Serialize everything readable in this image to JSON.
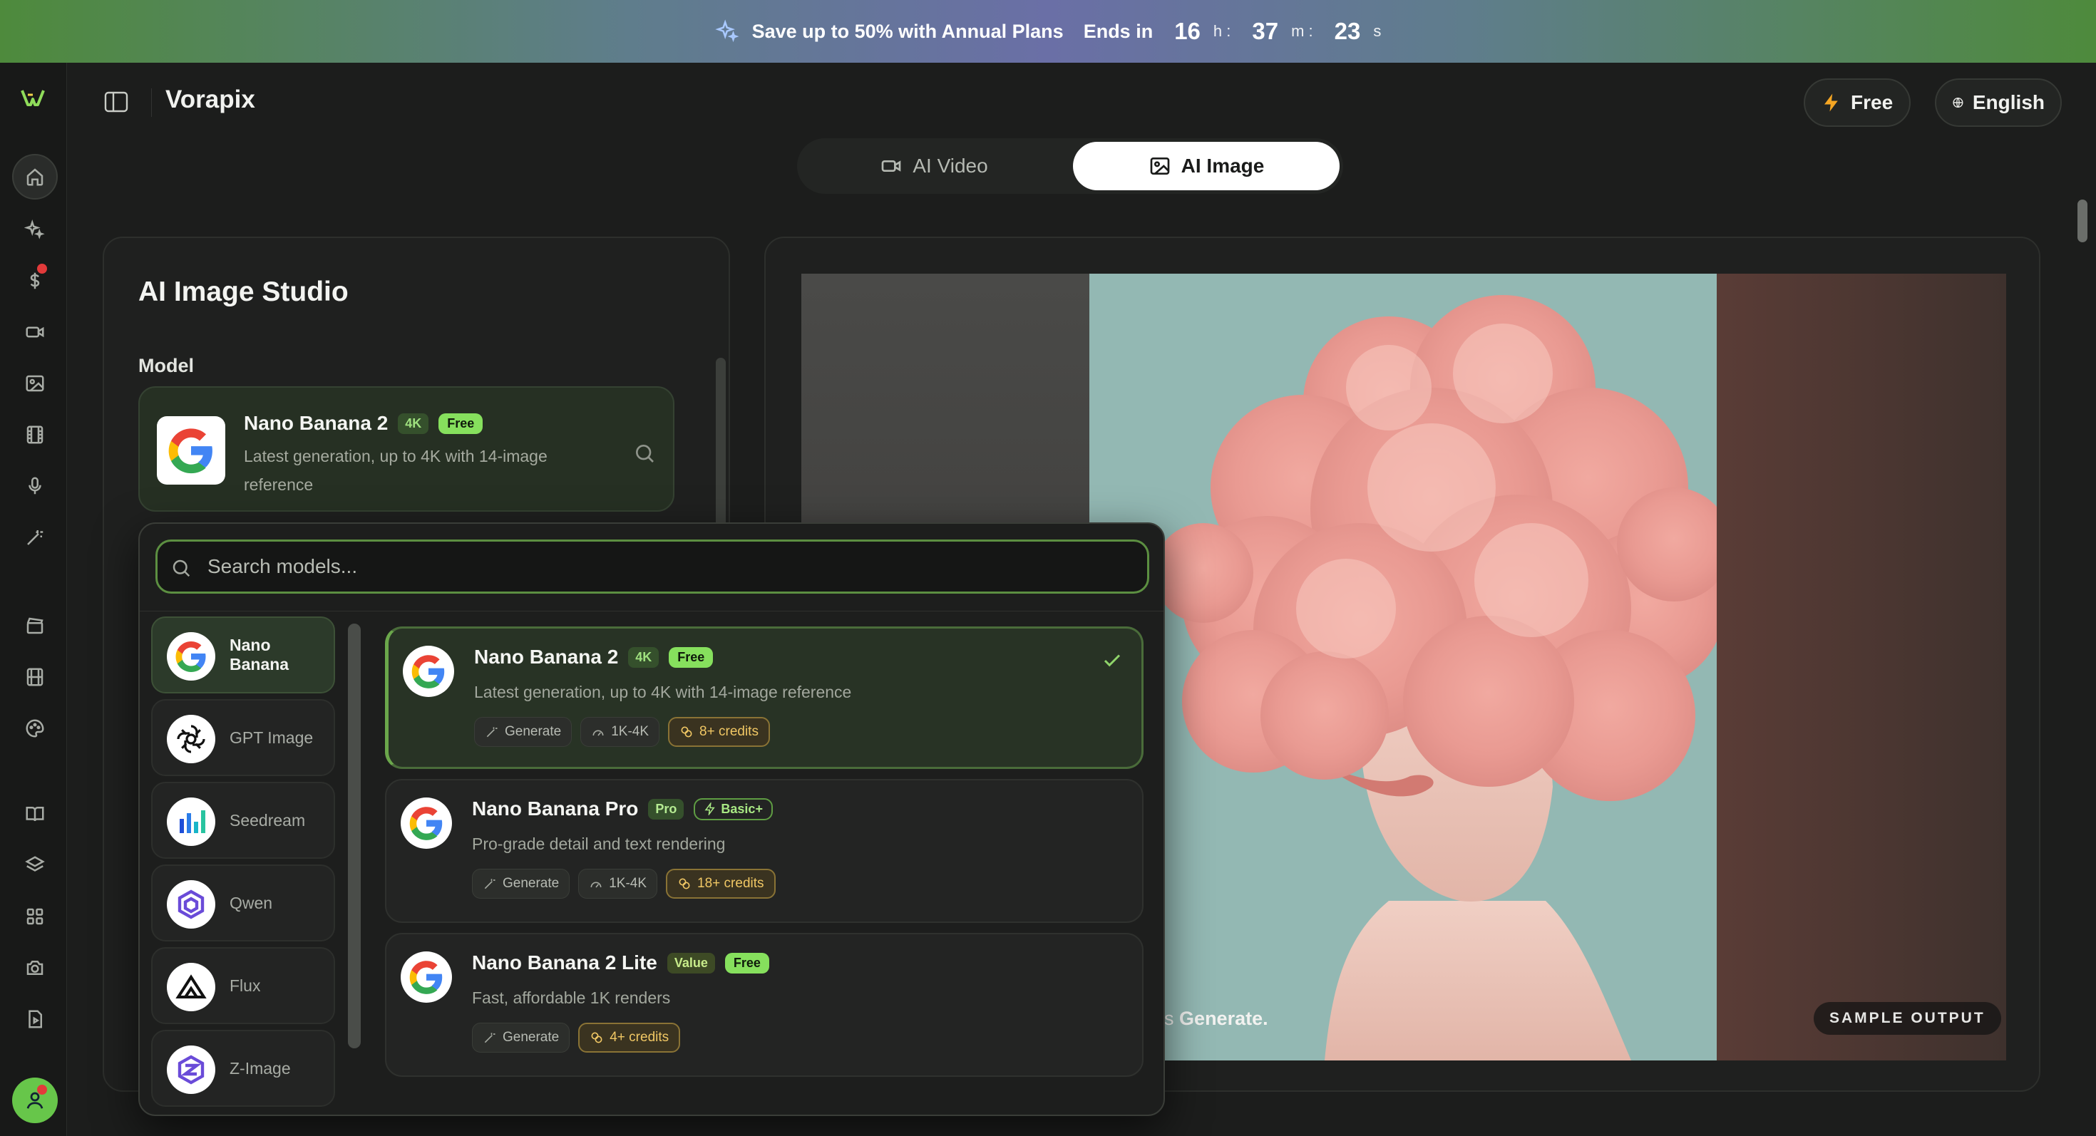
{
  "banner": {
    "text": "Save up to 50% with Annual Plans",
    "ends_label": "Ends in",
    "hours": "16",
    "hours_unit": "h :",
    "minutes": "37",
    "minutes_unit": "m :",
    "seconds": "23",
    "seconds_unit": "s"
  },
  "header": {
    "brand": "Vorapix",
    "plan_label": "Free",
    "language_label": "English"
  },
  "modes": {
    "video_label": "AI Video",
    "image_label": "AI Image",
    "active": "AI Image"
  },
  "studio": {
    "title": "AI Image Studio",
    "model_label": "Model",
    "selected": {
      "name": "Nano Banana 2",
      "badge_res": "4K",
      "badge_tier": "Free",
      "description": "Latest generation, up to 4K with 14-image reference"
    }
  },
  "preview": {
    "hint_prefix": "d press ",
    "hint_bold": "Generate.",
    "sample_label": "SAMPLE OUTPUT"
  },
  "dropdown": {
    "search_placeholder": "Search models...",
    "families": [
      {
        "label": "Nano Banana",
        "icon": "google-icon",
        "active": true
      },
      {
        "label": "GPT Image",
        "icon": "openai-icon",
        "active": false
      },
      {
        "label": "Seedream",
        "icon": "seedream-icon",
        "active": false
      },
      {
        "label": "Qwen",
        "icon": "qwen-icon",
        "active": false
      },
      {
        "label": "Flux",
        "icon": "flux-icon",
        "active": false
      },
      {
        "label": "Z-Image",
        "icon": "z-image-icon",
        "active": false
      }
    ],
    "models": [
      {
        "name": "Nano Banana 2",
        "badges": [
          "4K",
          "Free"
        ],
        "description": "Latest generation, up to 4K with 14-image reference",
        "chips": {
          "mode": "Generate",
          "resolution": "1K-4K",
          "credits": "8+ credits"
        },
        "selected": true
      },
      {
        "name": "Nano Banana Pro",
        "badges": [
          "Pro",
          "Basic+"
        ],
        "description": "Pro-grade detail and text rendering",
        "chips": {
          "mode": "Generate",
          "resolution": "1K-4K",
          "credits": "18+ credits"
        },
        "selected": false
      },
      {
        "name": "Nano Banana 2 Lite",
        "badges": [
          "Value",
          "Free"
        ],
        "description": "Fast, affordable 1K renders",
        "chips": {
          "mode": "Generate",
          "credits": "4+ credits"
        },
        "selected": false
      }
    ]
  },
  "colors": {
    "accent_green": "#6ba74b",
    "free_badge": "#86e05d",
    "credit_gold": "#f0c764",
    "background": "#1c1d1c"
  }
}
